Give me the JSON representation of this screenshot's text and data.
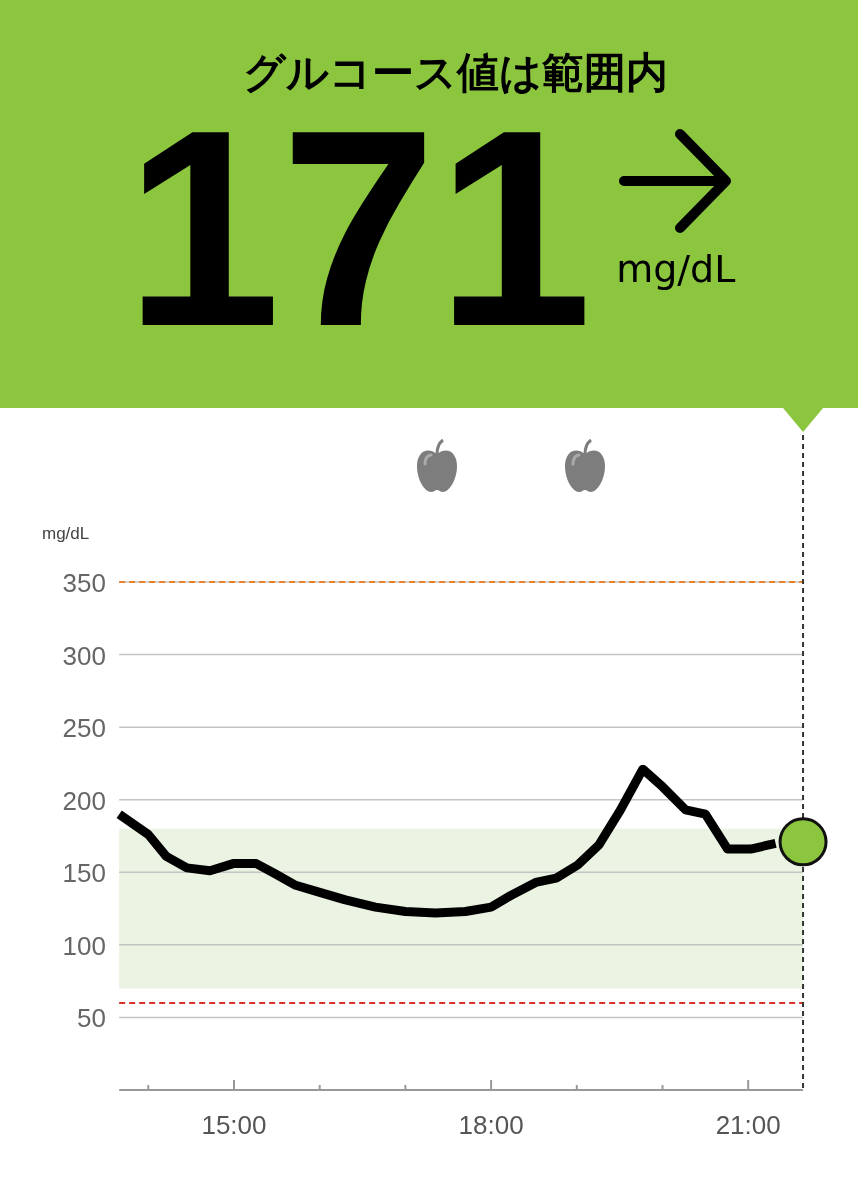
{
  "header": {
    "status": "グルコース値は範囲内",
    "value": "171",
    "unit": "mg/dL"
  },
  "chart": {
    "chart_data": {
      "type": "line",
      "ylabel": "mg/dL",
      "xlim": [
        13.66,
        21.64
      ],
      "ylim": [
        0,
        350
      ],
      "grid": true,
      "yticks": [
        50,
        100,
        150,
        200,
        250,
        300,
        350
      ],
      "xticks": [
        {
          "value": 15,
          "label": "15:00"
        },
        {
          "value": 18,
          "label": "18:00"
        },
        {
          "value": 21,
          "label": "21:00"
        }
      ],
      "x": [
        13.66,
        14.0,
        14.21,
        14.45,
        14.72,
        14.99,
        15.26,
        15.48,
        15.72,
        16.01,
        16.3,
        16.65,
        17.0,
        17.35,
        17.7,
        18.0,
        18.23,
        18.52,
        18.76,
        19.01,
        19.26,
        19.51,
        19.77,
        20.0,
        20.27,
        20.5,
        20.76,
        21.03,
        21.32
      ],
      "series": [
        {
          "color": "#000000",
          "values": [
            190,
            176,
            161,
            153,
            151,
            156,
            156,
            149,
            141,
            136,
            131,
            126,
            123,
            122,
            123,
            126,
            134,
            143,
            146,
            155,
            169,
            193,
            221,
            209,
            193,
            190,
            166,
            166,
            170
          ]
        }
      ],
      "bands": [
        {
          "axis": "y",
          "from": 70,
          "to": 180,
          "color": "#ebf4e2"
        }
      ],
      "ref_lines": [
        {
          "axis": "y",
          "value": 350,
          "color": "#e8822a"
        },
        {
          "axis": "y",
          "value": 60,
          "color": "#d9302c"
        }
      ]
    },
    "meal_markers": [
      {
        "kind": "meal"
      },
      {
        "kind": "meal"
      }
    ]
  }
}
